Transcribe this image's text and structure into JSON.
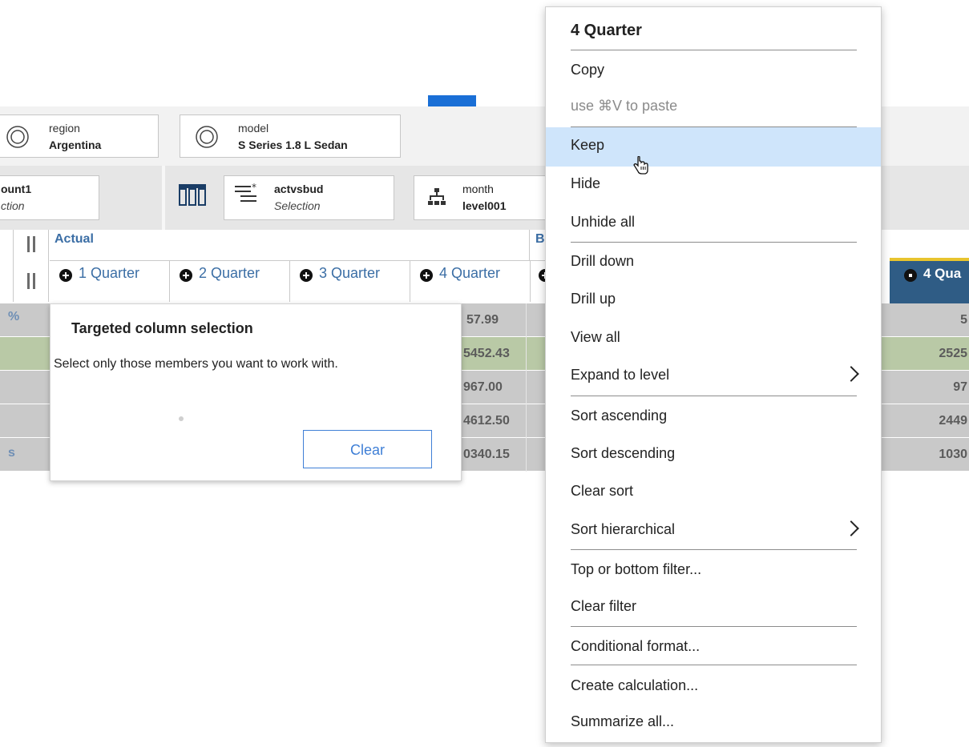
{
  "context_filters": [
    {
      "label": "region",
      "value": "Argentina"
    },
    {
      "label": "model",
      "value": "S Series 1.8 L Sedan"
    }
  ],
  "edge_tiles": [
    {
      "line1": "ount1",
      "line2": "ction"
    },
    {
      "line1": "actvsbud",
      "line2": "Selection"
    },
    {
      "line1": "month",
      "line2": "level001"
    }
  ],
  "grid": {
    "group_headers": [
      "Actual",
      "B"
    ],
    "columns": [
      "1 Quarter",
      "2 Quarter",
      "3 Quarter",
      "4 Quarter",
      "4 Qua"
    ],
    "row_stubs": [
      "%",
      "",
      "",
      "",
      "s"
    ],
    "col4_values": [
      "57.99",
      "5452.43",
      "967.00",
      "4612.50",
      "0340.15"
    ],
    "right_values": [
      "5",
      "2525",
      "97",
      "2449",
      "1030"
    ]
  },
  "popover": {
    "title": "Targeted column selection",
    "description": "Select only those members you want to work with.",
    "clear_label": "Clear"
  },
  "menu": {
    "title": "4 Quarter",
    "items": [
      {
        "label": "Copy"
      },
      {
        "label": "use ⌘V to paste",
        "disabled": true
      },
      {
        "label": "Keep",
        "highlighted": true
      },
      {
        "label": "Hide"
      },
      {
        "label": "Unhide all"
      },
      {
        "label": "Drill down"
      },
      {
        "label": "Drill up"
      },
      {
        "label": "View all"
      },
      {
        "label": "Expand to level",
        "submenu": true
      },
      {
        "label": "Sort ascending"
      },
      {
        "label": "Sort descending"
      },
      {
        "label": "Clear sort"
      },
      {
        "label": "Sort hierarchical",
        "submenu": true
      },
      {
        "label": "Top or bottom filter..."
      },
      {
        "label": "Clear filter"
      },
      {
        "label": "Conditional format..."
      },
      {
        "label": "Create calculation..."
      },
      {
        "label": "Summarize all..."
      }
    ]
  },
  "colors": {
    "accent": "#1a6fd6",
    "header_text": "#3b6ea5",
    "selected_col": "#2f5c85",
    "highlight": "#cfe5fb"
  }
}
